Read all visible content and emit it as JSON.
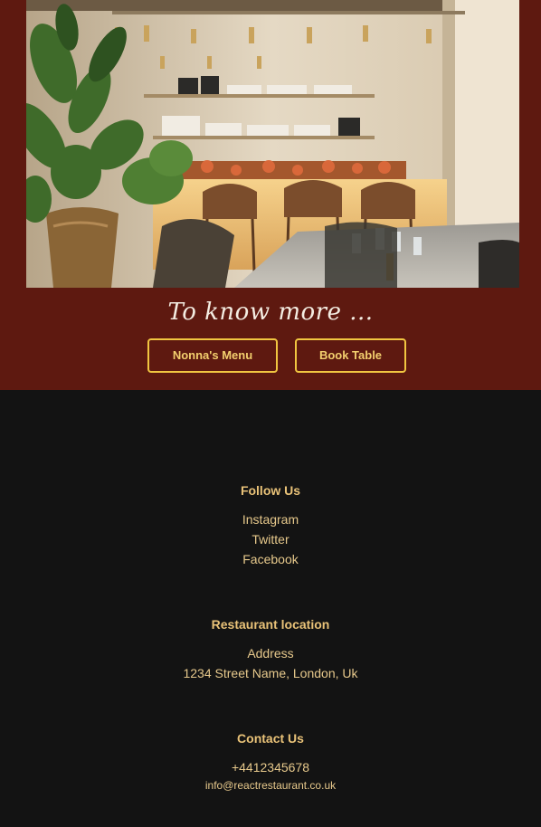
{
  "hero": {
    "tagline": "To know more ...",
    "buttons": {
      "menu_label": "Nonna's Menu",
      "book_label": "Book Table"
    }
  },
  "footer": {
    "follow": {
      "heading": "Follow Us",
      "links": [
        "Instagram",
        "Twitter",
        "Facebook"
      ]
    },
    "location": {
      "heading": "Restaurant location",
      "address_label": "Address",
      "address": "1234 Street Name, London, Uk"
    },
    "contact": {
      "heading": "Contact Us",
      "phone": "+4412345678",
      "email": "info@reactrestaurant.co.uk"
    }
  },
  "colors": {
    "hero_background": "#5e1910",
    "footer_background": "#131313",
    "accent_gold": "#f1c641",
    "footer_text": "#e7c98c"
  }
}
